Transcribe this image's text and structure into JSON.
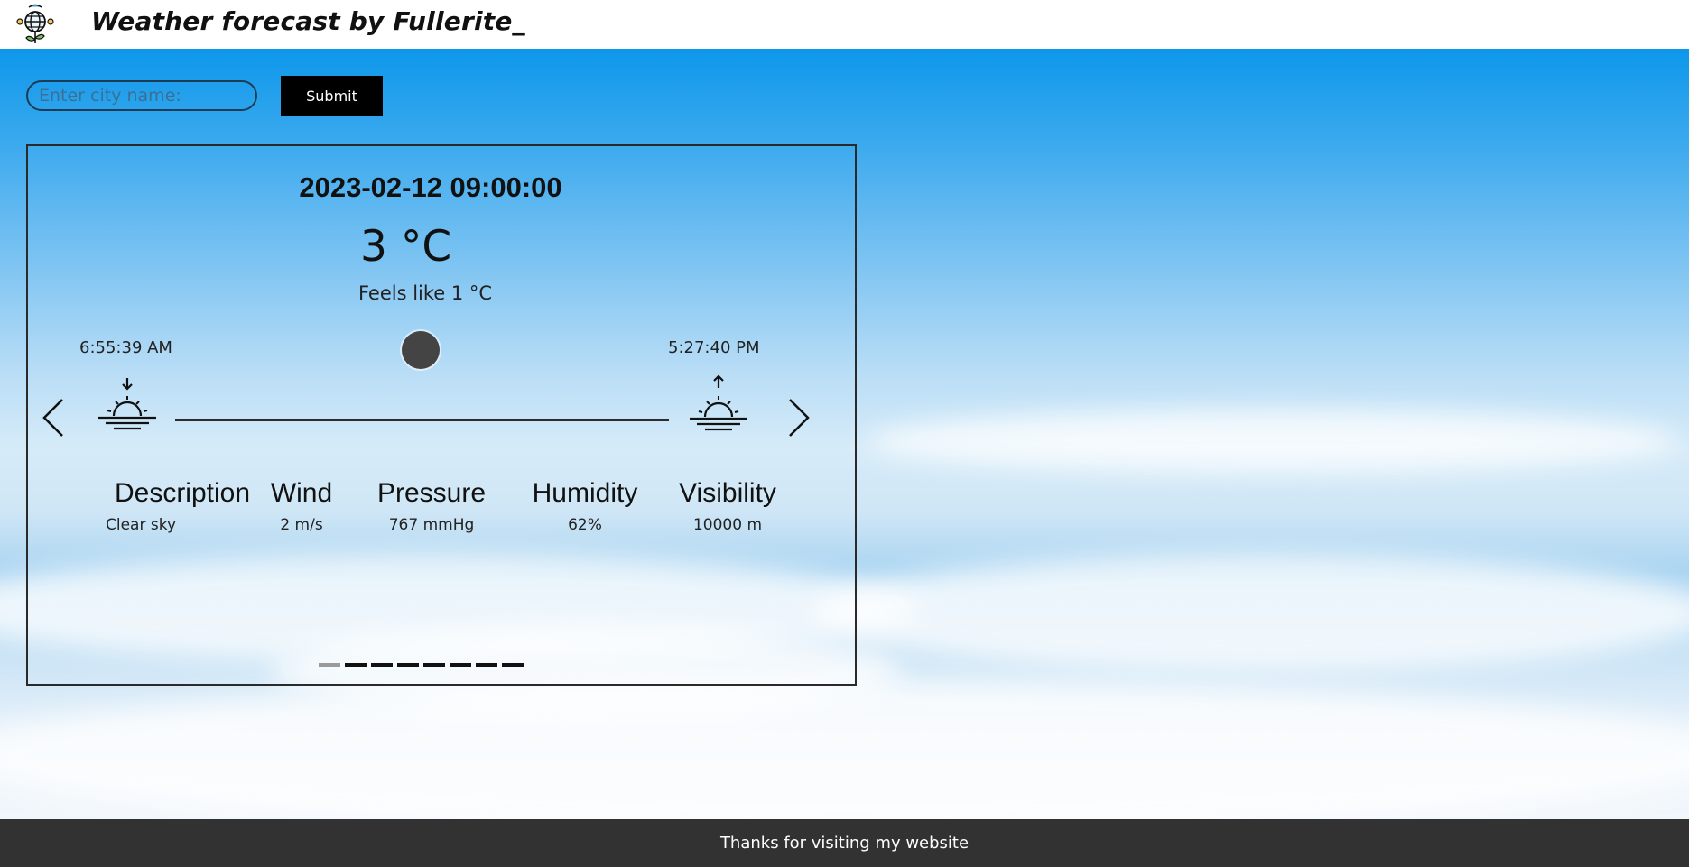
{
  "header": {
    "title": "Weather forecast by Fullerite_",
    "logo_icon": "globe-weather-logo-icon"
  },
  "search": {
    "placeholder": "Enter city name:",
    "value": "",
    "submit_label": "Submit"
  },
  "forecast": {
    "datetime": "2023-02-12 09:00:00",
    "temperature": "3 °C",
    "feels_like": "Feels like 1 °C",
    "sunrise": "6:55:39 AM",
    "sunset": "5:27:40 PM",
    "sun_progress": 0.5,
    "stats": {
      "description": {
        "label": "Description",
        "value": "Clear sky"
      },
      "wind": {
        "label": "Wind",
        "value": "2 m/s"
      },
      "pressure": {
        "label": "Pressure",
        "value": "767 mmHg"
      },
      "humidity": {
        "label": "Humidity",
        "value": "62%"
      },
      "visibility": {
        "label": "Visibility",
        "value": "10000 m"
      }
    },
    "pager": {
      "total": 8,
      "active_index": 0
    }
  },
  "icons": {
    "prev": "chevron-left-icon",
    "next": "chevron-right-icon",
    "sunrise": "sunrise-icon",
    "sunset": "sunset-icon"
  },
  "colors": {
    "footer_bg": "#323232",
    "button_bg": "#000000",
    "sun_dot": "#444444"
  },
  "footer": {
    "text": "Thanks for visiting my website"
  }
}
